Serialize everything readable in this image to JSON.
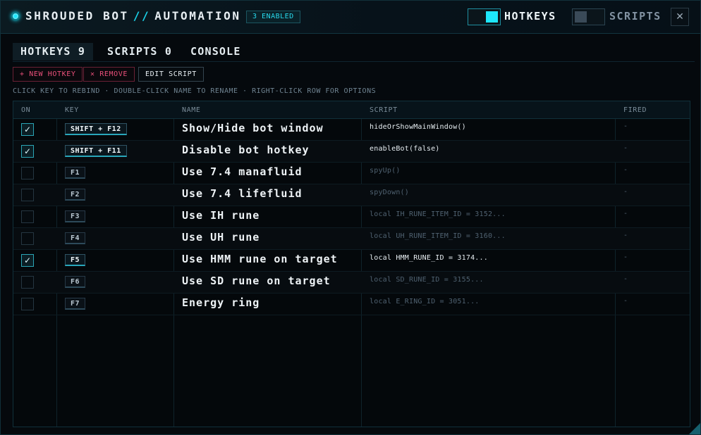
{
  "header": {
    "title_left": "SHROUDED BOT",
    "title_sep": "//",
    "title_right": "AUTOMATION",
    "enabled_badge": "3 ENABLED",
    "hotkeys_toggle_label": "HOTKEYS",
    "scripts_toggle_label": "SCRIPTS",
    "close_glyph": "✕"
  },
  "tabs": [
    {
      "label": "HOTKEYS 9"
    },
    {
      "label": "SCRIPTS 0"
    },
    {
      "label": "CONSOLE"
    }
  ],
  "toolbar": {
    "new_hotkey": "+ NEW HOTKEY",
    "remove": "✕ REMOVE",
    "edit_script": "EDIT SCRIPT"
  },
  "hint": "CLICK KEY TO REBIND · DOUBLE-CLICK NAME TO RENAME · RIGHT-CLICK ROW FOR OPTIONS",
  "table": {
    "columns": {
      "on": "ON",
      "key": "KEY",
      "name": "NAME",
      "script": "SCRIPT",
      "fired": "FIRED"
    },
    "check_glyph": "✓",
    "rows": [
      {
        "on": true,
        "key": "SHIFT + F12",
        "name": "Show/Hide bot window",
        "script": "hideOrShowMainWindow()",
        "fired": "-"
      },
      {
        "on": true,
        "key": "SHIFT + F11",
        "name": "Disable bot hotkey",
        "script": "enableBot(false)",
        "fired": "-"
      },
      {
        "on": false,
        "key": "F1",
        "name": "Use 7.4 manafluid",
        "script": "spyUp()",
        "fired": "-"
      },
      {
        "on": false,
        "key": "F2",
        "name": "Use 7.4 lifefluid",
        "script": "spyDown()",
        "fired": "-"
      },
      {
        "on": false,
        "key": "F3",
        "name": "Use IH rune",
        "script": "local IH_RUNE_ITEM_ID = 3152...",
        "fired": "-"
      },
      {
        "on": false,
        "key": "F4",
        "name": "Use UH rune",
        "script": "local UH_RUNE_ITEM_ID = 3160...",
        "fired": "-"
      },
      {
        "on": true,
        "key": "F5",
        "name": "Use HMM rune on target",
        "script": "local HMM_RUNE_ID = 3174...",
        "fired": "-"
      },
      {
        "on": false,
        "key": "F6",
        "name": "Use SD rune on target",
        "script": "local SD_RUNE_ID = 3155...",
        "fired": "-"
      },
      {
        "on": false,
        "key": "F7",
        "name": "Energy ring",
        "script": "local E_RING_ID = 3051...",
        "fired": "-"
      }
    ]
  },
  "colors": {
    "accent": "#1ce8ff",
    "danger": "#e9507a",
    "background": "#05090d"
  }
}
